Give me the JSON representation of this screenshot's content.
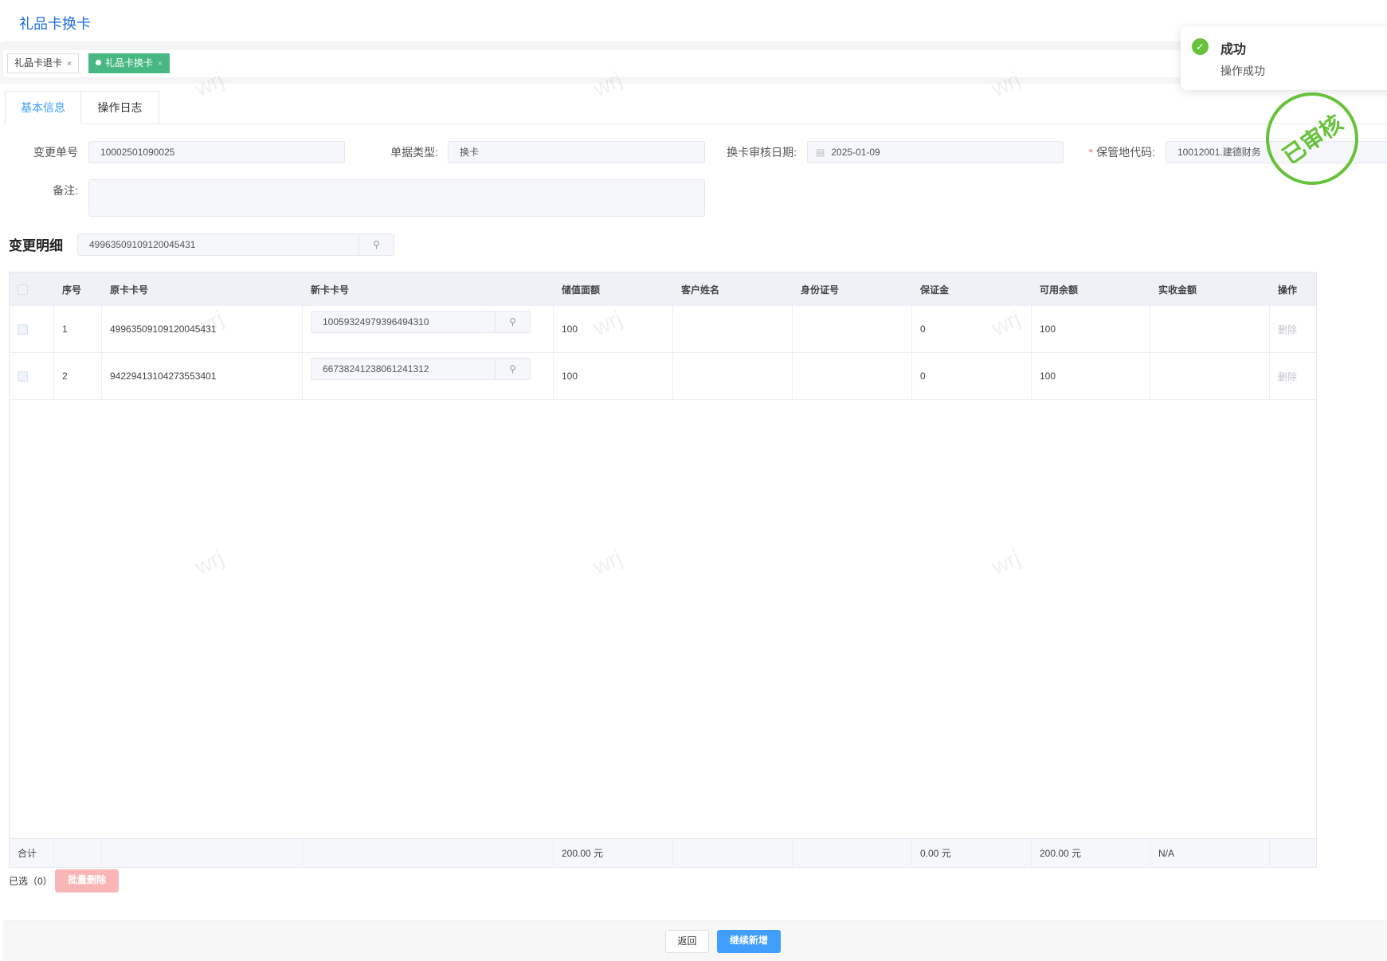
{
  "header": {
    "title": "礼品卡换卡"
  },
  "tags": [
    {
      "label": "礼品卡退卡",
      "close": "×"
    },
    {
      "label": "礼品卡换卡",
      "close": "×"
    }
  ],
  "tabs": [
    "基本信息",
    "操作日志"
  ],
  "form": {
    "change_no": {
      "label": "变更单号",
      "value": "10002501090025"
    },
    "doc_type": {
      "label": "单据类型:",
      "value": "换卡"
    },
    "audit_date": {
      "label": "换卡审核日期:",
      "value": "2025-01-09"
    },
    "storage_code": {
      "label": "保管地代码:",
      "required": "*",
      "value": "10012001.建德财务"
    },
    "remark": {
      "label": "备注:",
      "value": ""
    }
  },
  "detail": {
    "title": "变更明细",
    "search_value": "49963509109120045431"
  },
  "table": {
    "columns": [
      "",
      "序号",
      "原卡卡号",
      "新卡卡号",
      "储值面额",
      "客户姓名",
      "身份证号",
      "保证金",
      "可用余额",
      "实收金额",
      "操作"
    ],
    "rows": [
      {
        "seq": "1",
        "old_card": "49963509109120045431",
        "new_card": "10059324979396494310",
        "face": "100",
        "name": "",
        "id": "",
        "deposit": "0",
        "balance": "100",
        "received": "",
        "action": "删除"
      },
      {
        "seq": "2",
        "old_card": "94229413104273553401",
        "new_card": "66738241238061241312",
        "face": "100",
        "name": "",
        "id": "",
        "deposit": "0",
        "balance": "100",
        "received": "",
        "action": "删除"
      }
    ],
    "footer": {
      "label": "合计",
      "face": "200.00 元",
      "deposit": "0.00 元",
      "balance": "200.00 元",
      "received": "N/A"
    }
  },
  "selection": {
    "label": "已选（0）",
    "batch_delete": "批量删除"
  },
  "actions": {
    "back": "返回",
    "continue": "继续新增"
  },
  "toast": {
    "title": "成功",
    "message": "操作成功"
  },
  "stamp": {
    "text": "已审核"
  },
  "watermark": "wrj",
  "colors": {
    "primary": "#409eff",
    "tag_active": "#47b881",
    "success": "#67c23a"
  }
}
